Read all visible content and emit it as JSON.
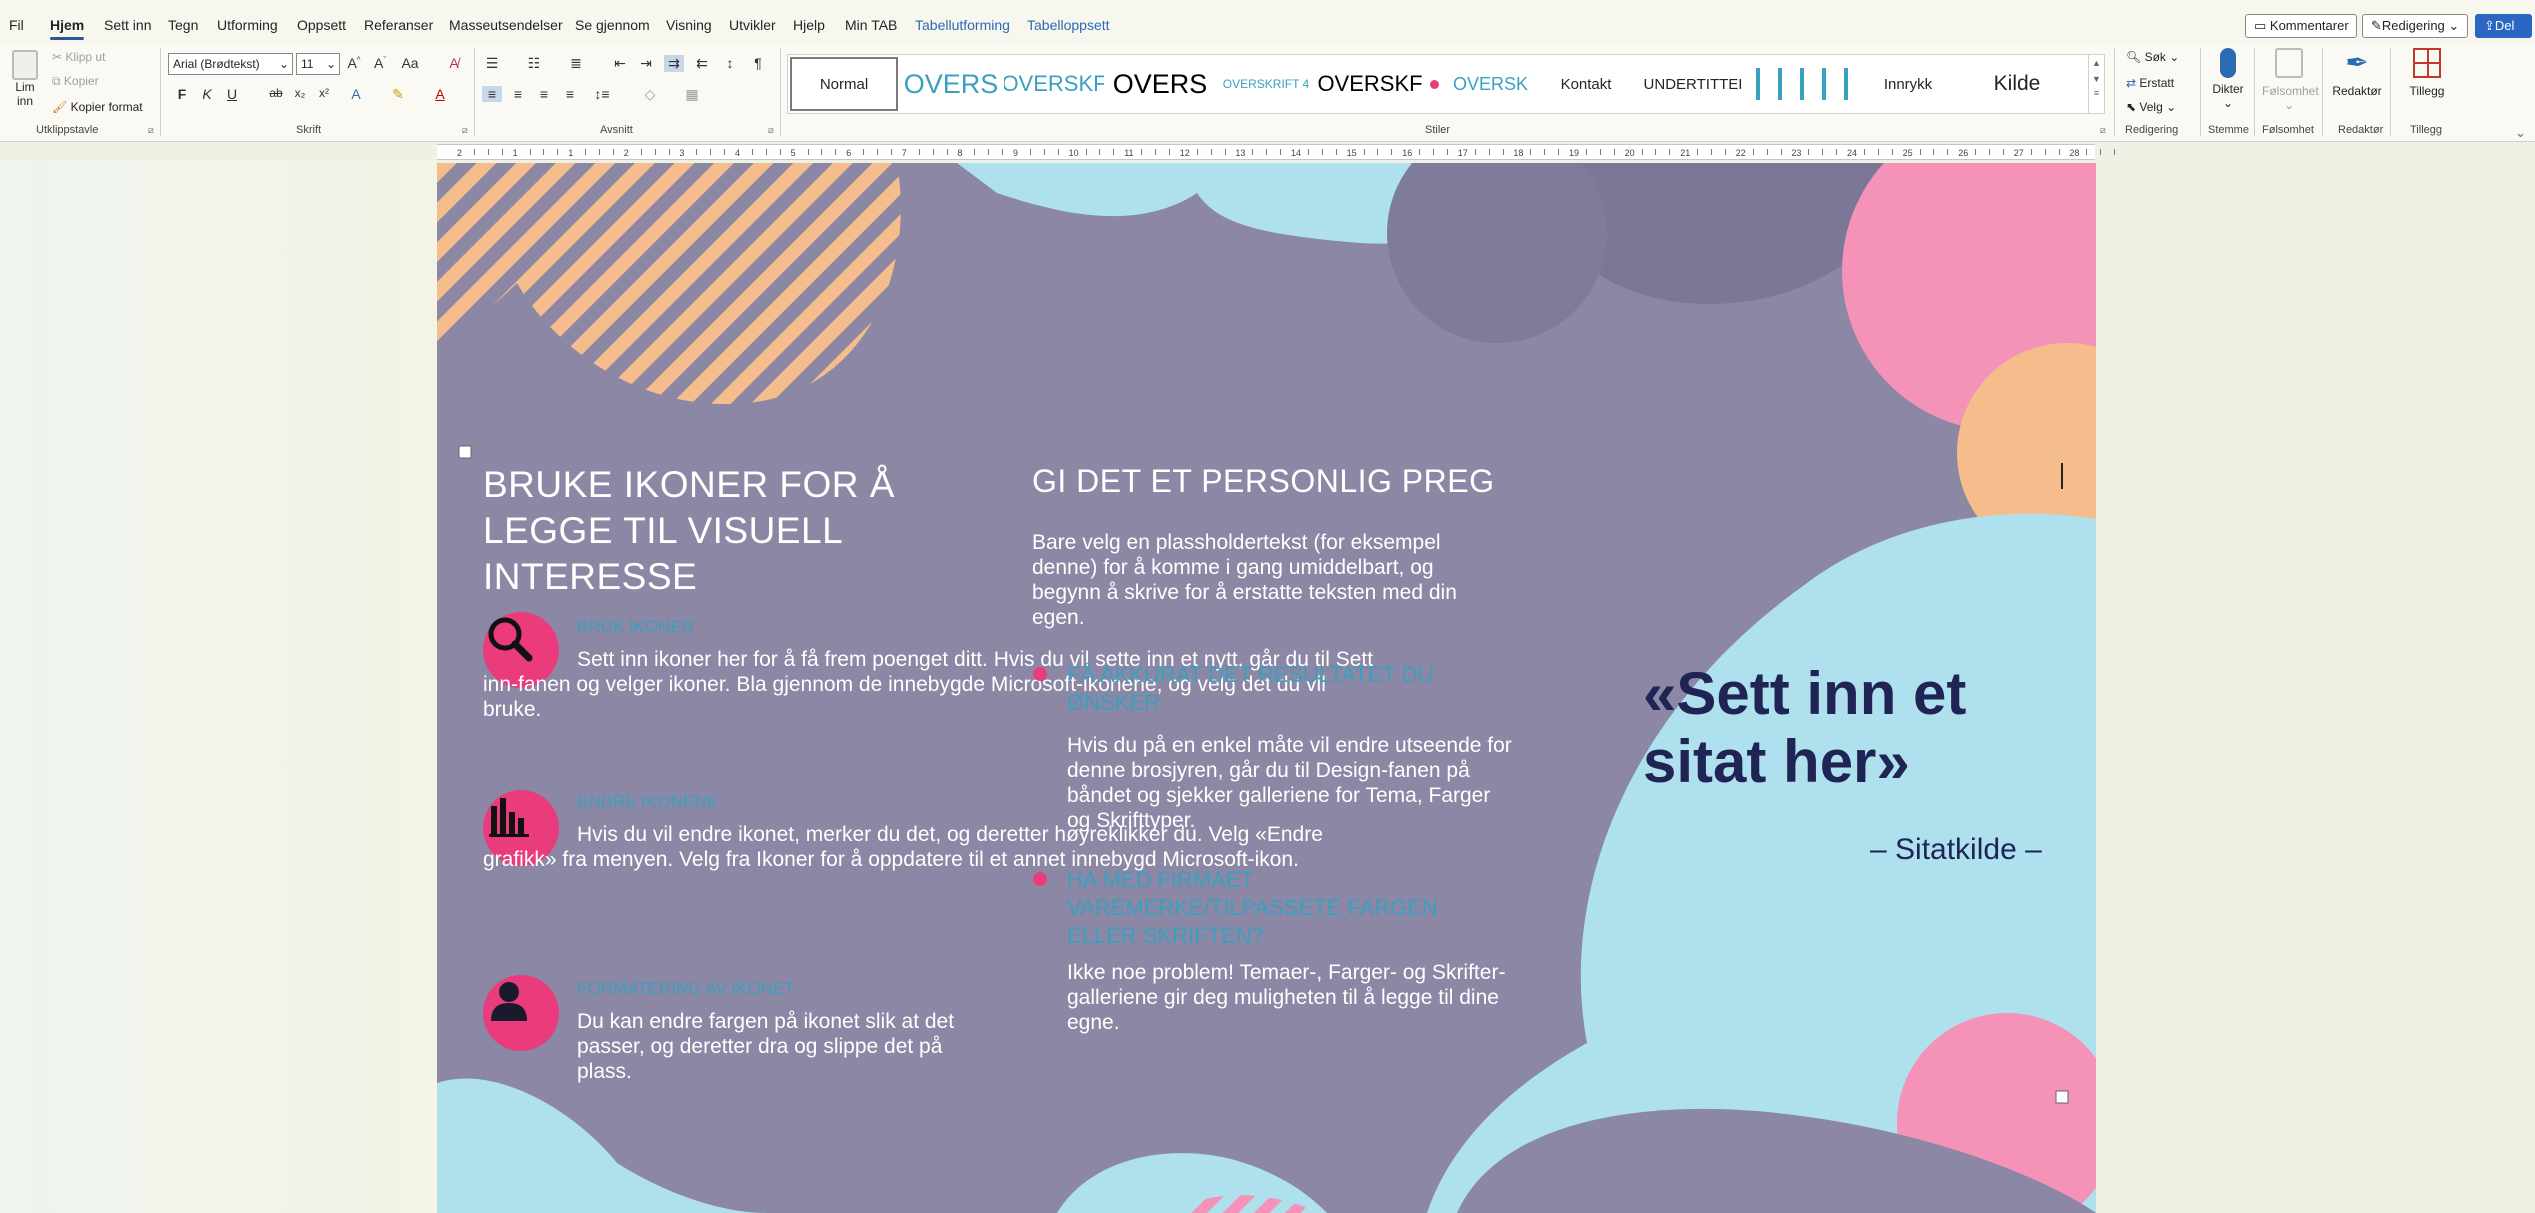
{
  "menu": {
    "items": [
      "Fil",
      "Hjem",
      "Sett inn",
      "Tegn",
      "Utforming",
      "Oppsett",
      "Referanser",
      "Masseutsendelser",
      "Se gjennom",
      "Visning",
      "Utvikler",
      "Hjelp",
      "Min TAB"
    ],
    "context_tabs": [
      "Tabellutforming",
      "Tabelloppsett"
    ],
    "active": "Hjem",
    "comments": "Kommentarer",
    "editing": "Redigering",
    "share": "Del"
  },
  "ribbon": {
    "clipboard": {
      "paste": "Lim",
      "paste2": "inn",
      "cut": "Klipp ut",
      "copy": "Kopier",
      "format_painter": "Kopier format",
      "label": "Utklippstavle"
    },
    "font": {
      "family": "Arial (Brødtekst)",
      "size": "11",
      "label": "Skrift",
      "bold": "F",
      "italic": "K",
      "underline": "U"
    },
    "paragraph": {
      "label": "Avsnitt"
    },
    "styles": {
      "label": "Stiler",
      "items": [
        {
          "name": "Normal",
          "color": "#000000"
        },
        {
          "name": "OVERS",
          "color": "#3aa0c0"
        },
        {
          "name": "OVERSKF",
          "color": "#3aa0c0"
        },
        {
          "name": "OVERS",
          "color": "#000000"
        },
        {
          "name": "OVERSKRIFT 4",
          "color": "#3aa0c0"
        },
        {
          "name": "OVERSKF",
          "color": "#000000"
        },
        {
          "name": "OVERSK",
          "color": "#3aa0c0"
        },
        {
          "name": "Kontakt",
          "color": "#000000"
        },
        {
          "name": "UNDERTITTEI",
          "color": "#000000"
        },
        {
          "name": "Innrykk",
          "color": "#000000"
        },
        {
          "name": "Kilde",
          "color": "#000000"
        }
      ]
    },
    "editing": {
      "search": "Søk",
      "replace": "Erstatt",
      "select": "Velg",
      "label": "Redigering"
    },
    "voice": {
      "dictate": "Dikter",
      "label": "Stemme"
    },
    "sensitivity": {
      "name": "Følsomhet",
      "label": "Følsomhet"
    },
    "editor": {
      "name": "Redaktør",
      "label": "Redaktør"
    },
    "addins": {
      "name": "Tillegg",
      "label": "Tillegg"
    }
  },
  "ruler": {
    "numbers": [
      "2",
      "1",
      "1",
      "2",
      "3",
      "4",
      "5",
      "6",
      "7",
      "8",
      "9",
      "10",
      "11",
      "12",
      "13",
      "14",
      "15",
      "16",
      "17",
      "18",
      "19",
      "20",
      "21",
      "22",
      "23",
      "24",
      "25",
      "26",
      "27",
      "28"
    ]
  },
  "doc": {
    "left_heading": "BRUKE IKONER FOR Å LEGGE TIL VISUELL INTERESSE",
    "items": [
      {
        "sub": "BRUK IKONER",
        "body": "Sett inn ikoner her for å få frem poenget ditt. Hvis du vil sette inn et nytt, går du til Sett inn-fanen og velger ikoner. Bla gjennom de innebygde Microsoft-ikonene, og velg det du vil bruke.",
        "icon": "magnifier-icon"
      },
      {
        "sub": "ENDRE IKONENE",
        "body": "Hvis du vil endre ikonet, merker du det, og deretter høyreklikker du. Velg «Endre grafikk» fra menyen. Velg fra Ikoner for å oppdatere til et annet innebygd Microsoft-ikon.",
        "icon": "bar-chart-icon"
      },
      {
        "sub": "FORMATERING AV IKONET",
        "body": "Du kan endre fargen på ikonet slik at det passer, og deretter dra og slippe det på plass.",
        "icon": "person-icon"
      }
    ],
    "mid_heading": "GI DET ET PERSONLIG PREG",
    "mid_intro": "Bare velg en plassholdertekst (for eksempel denne) for å komme i gang umiddelbart, og begynn å skrive for å erstatte teksten med din egen.",
    "bullets": [
      {
        "title": "FÅ AKKURAT DET RESULTATET DU ØNSKER",
        "body": "Hvis du på en enkel måte vil endre utseende for denne brosjyren, går du til Design-fanen på båndet og sjekker galleriene for Tema, Farger og Skrifttyper."
      },
      {
        "title": "HA MED FIRMAET VAREMERKE/TILPASSETE FARGEN ELLER SKRIFTEN?",
        "body": "Ikke noe problem! Temaer-, Farger- og Skrifter-galleriene gir deg muligheten til å legge til dine egne."
      }
    ],
    "quote": "«Sett inn et sitat her»",
    "quote_source": "– Sitatkilde –"
  },
  "colors": {
    "accent": "#ea3c7c",
    "subhead": "#3aa0c0",
    "page_bg": "#8b87a4",
    "light_blue": "#aee0ee",
    "pink": "#f493b7",
    "peach": "#f5bc8c",
    "navy": "#1f2454",
    "word_blue": "#2b579a"
  }
}
